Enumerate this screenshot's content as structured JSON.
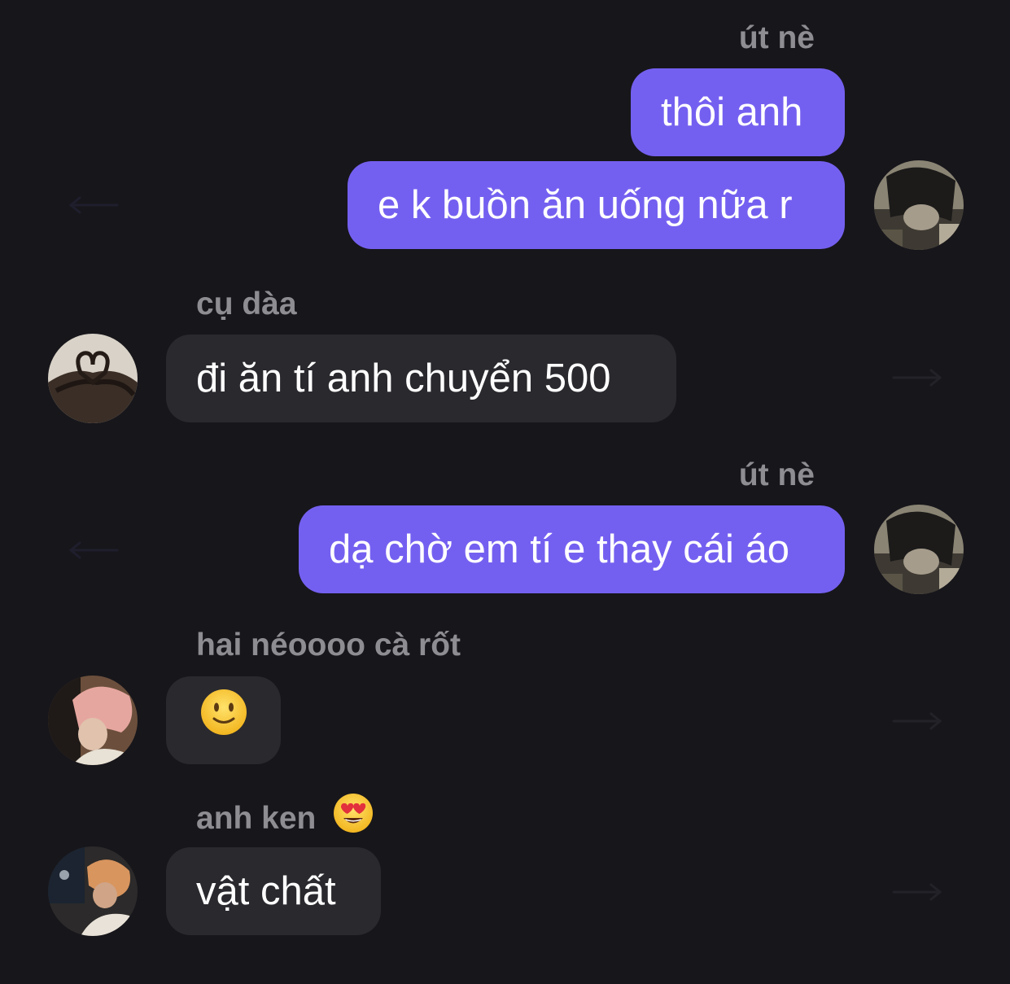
{
  "messages": [
    {
      "id": 1,
      "direction": "outgoing",
      "sender": "út nè",
      "text": "thôi anh"
    },
    {
      "id": 2,
      "direction": "outgoing",
      "text": "e k buồn ăn uống nữa r"
    },
    {
      "id": 3,
      "direction": "incoming",
      "sender": "cụ dàa",
      "text": "đi ăn tí anh chuyển 500"
    },
    {
      "id": 4,
      "direction": "outgoing",
      "sender": "út nè",
      "text": "dạ chờ em tí e thay cái áo"
    },
    {
      "id": 5,
      "direction": "incoming",
      "sender": "hai néoooo cà rốt",
      "emoji": "slightly-smiling-face"
    },
    {
      "id": 6,
      "direction": "incoming",
      "sender": "anh ken",
      "sender_emoji": "heart-eyes-face",
      "text": "vật chất"
    }
  ],
  "colors": {
    "background": "#17161b",
    "outgoing_bubble": "#7460f0",
    "incoming_bubble": "#2a292e",
    "sender_name": "#8e8d92",
    "text": "#ffffff"
  },
  "icons": {
    "reply_left": "arrow-left-icon",
    "reply_right": "arrow-right-icon"
  }
}
